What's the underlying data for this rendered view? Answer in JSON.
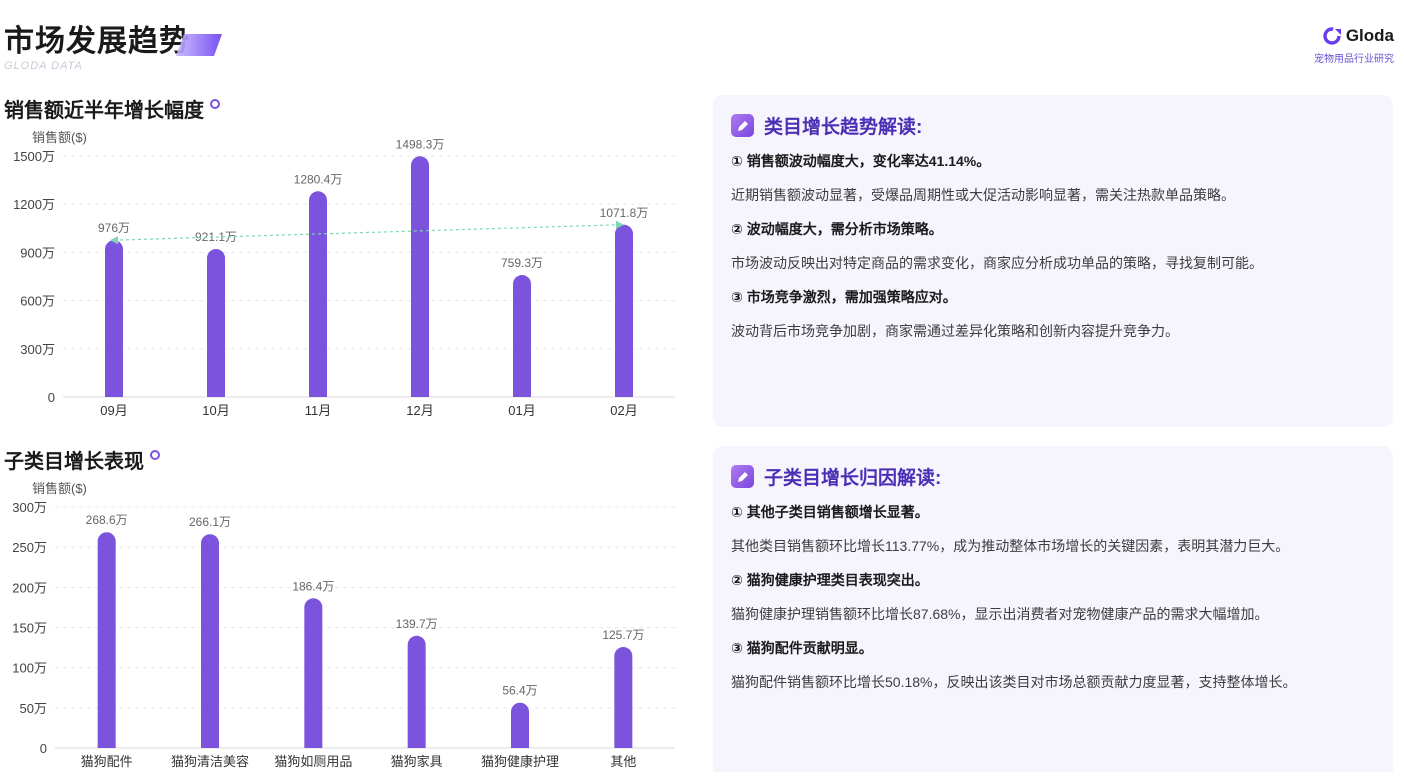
{
  "header": {
    "title": "市场发展趋势",
    "subtitle": "GLODA DATA",
    "brand_name": "Gloda",
    "brand_tagline": "宠物用品行业研究"
  },
  "sections": {
    "trend_title": "销售额近半年增长幅度",
    "sub_title": "子类目增长表现"
  },
  "panels": {
    "trend": {
      "title": "类目增长趋势解读:",
      "items": [
        {
          "head": "① 销售额波动幅度大，变化率达41.14%。",
          "body": "近期销售额波动显著，受爆品周期性或大促活动影响显著，需关注热款单品策略。"
        },
        {
          "head": "② 波动幅度大，需分析市场策略。",
          "body": "市场波动反映出对特定商品的需求变化，商家应分析成功单品的策略，寻找复制可能。"
        },
        {
          "head": "③ 市场竞争激烈，需加强策略应对。",
          "body": "波动背后市场竞争加剧，商家需通过差异化策略和创新内容提升竞争力。"
        }
      ]
    },
    "sub": {
      "title": "子类目增长归因解读:",
      "items": [
        {
          "head": "① 其他子类目销售额增长显著。",
          "body": "其他类目销售额环比增长113.77%，成为推动整体市场增长的关键因素，表明其潜力巨大。"
        },
        {
          "head": "② 猫狗健康护理类目表现突出。",
          "body": "猫狗健康护理销售额环比增长87.68%，显示出消费者对宠物健康产品的需求大幅增加。"
        },
        {
          "head": "③ 猫狗配件贡献明显。",
          "body": "猫狗配件销售额环比增长50.18%，反映出该类目对市场总额贡献力度显著，支持整体增长。"
        }
      ]
    }
  },
  "chart_data": [
    {
      "type": "bar",
      "ylabel": "销售额($)",
      "categories": [
        "09月",
        "10月",
        "11月",
        "12月",
        "01月",
        "02月"
      ],
      "values": [
        976,
        921.1,
        1280.4,
        1498.3,
        759.3,
        1071.8
      ],
      "value_labels": [
        "976万",
        "921.1万",
        "1280.4万",
        "1498.3万",
        "759.3万",
        "1071.8万"
      ],
      "yticks": [
        0,
        300,
        600,
        900,
        1200,
        1500
      ],
      "ytick_labels": [
        "0",
        "300万",
        "600万",
        "900万",
        "1200万",
        "1500万"
      ],
      "ylim": [
        0,
        1500
      ],
      "trendline": {
        "from": 976,
        "to": 1071.8
      },
      "colors": {
        "bar": "#7b53dc",
        "trend": "#7fd6b0"
      },
      "grid": true
    },
    {
      "type": "bar",
      "ylabel": "销售额($)",
      "categories": [
        "猫狗配件",
        "猫狗清洁美容",
        "猫狗如厕用品",
        "猫狗家具",
        "猫狗健康护理",
        "其他"
      ],
      "values": [
        268.6,
        266.1,
        186.4,
        139.7,
        56.4,
        125.7
      ],
      "value_labels": [
        "268.6万",
        "266.1万",
        "186.4万",
        "139.7万",
        "56.4万",
        "125.7万"
      ],
      "yticks": [
        0,
        50,
        100,
        150,
        200,
        250,
        300
      ],
      "ytick_labels": [
        "0",
        "50万",
        "100万",
        "150万",
        "200万",
        "250万",
        "300万"
      ],
      "ylim": [
        0,
        300
      ],
      "colors": {
        "bar": "#7b53dc"
      },
      "grid": true
    }
  ]
}
